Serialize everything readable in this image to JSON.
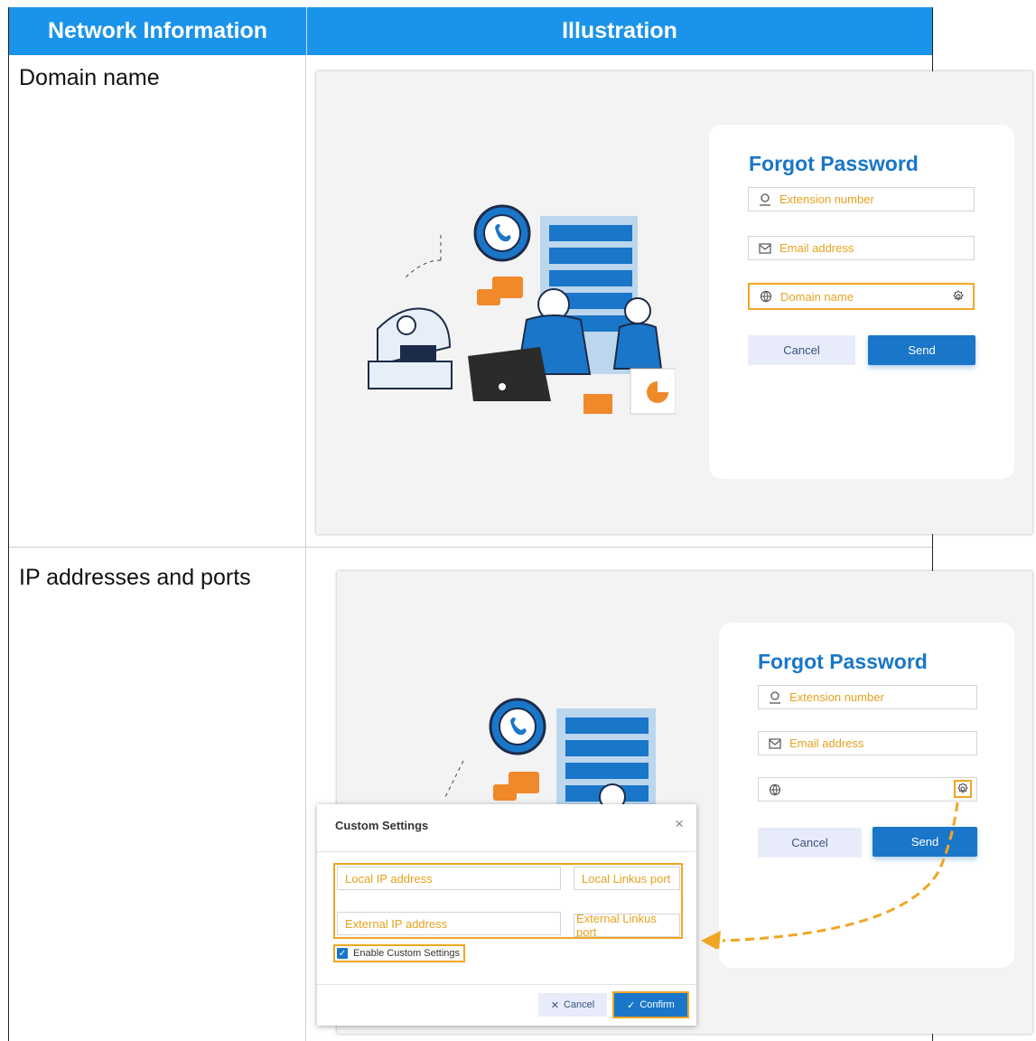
{
  "table": {
    "header": {
      "col1": "Network Information",
      "col2": "Illustration"
    },
    "rows": [
      {
        "label": "Domain name"
      },
      {
        "label": "IP addresses and ports"
      }
    ]
  },
  "panel1": {
    "title": "Forgot Password",
    "fields": [
      {
        "icon": "user-icon",
        "placeholder": "Extension number"
      },
      {
        "icon": "mail-icon",
        "placeholder": "Email address"
      },
      {
        "icon": "globe-icon",
        "placeholder": "Domain name"
      }
    ],
    "cancel": "Cancel",
    "send": "Send"
  },
  "panel2": {
    "title": "Forgot Password",
    "fields": [
      {
        "icon": "user-icon",
        "placeholder": "Extension number"
      },
      {
        "icon": "mail-icon",
        "placeholder": "Email address"
      },
      {
        "icon": "globe-icon",
        "placeholder": ""
      }
    ],
    "cancel": "Cancel",
    "send": "Send"
  },
  "dialog": {
    "title": "Custom Settings",
    "close": "×",
    "local_ip": "Local IP address",
    "local_port": "Local Linkus port",
    "external_ip": "External IP address",
    "external_port": "External Linkus port",
    "checkbox_label": "Enable Custom Settings",
    "cancel": "Cancel",
    "confirm": "Confirm"
  },
  "colors": {
    "header": "#1a93ea",
    "accent": "#1a76c8",
    "highlight": "#f0a623",
    "placeholder": "#e7a21f"
  }
}
